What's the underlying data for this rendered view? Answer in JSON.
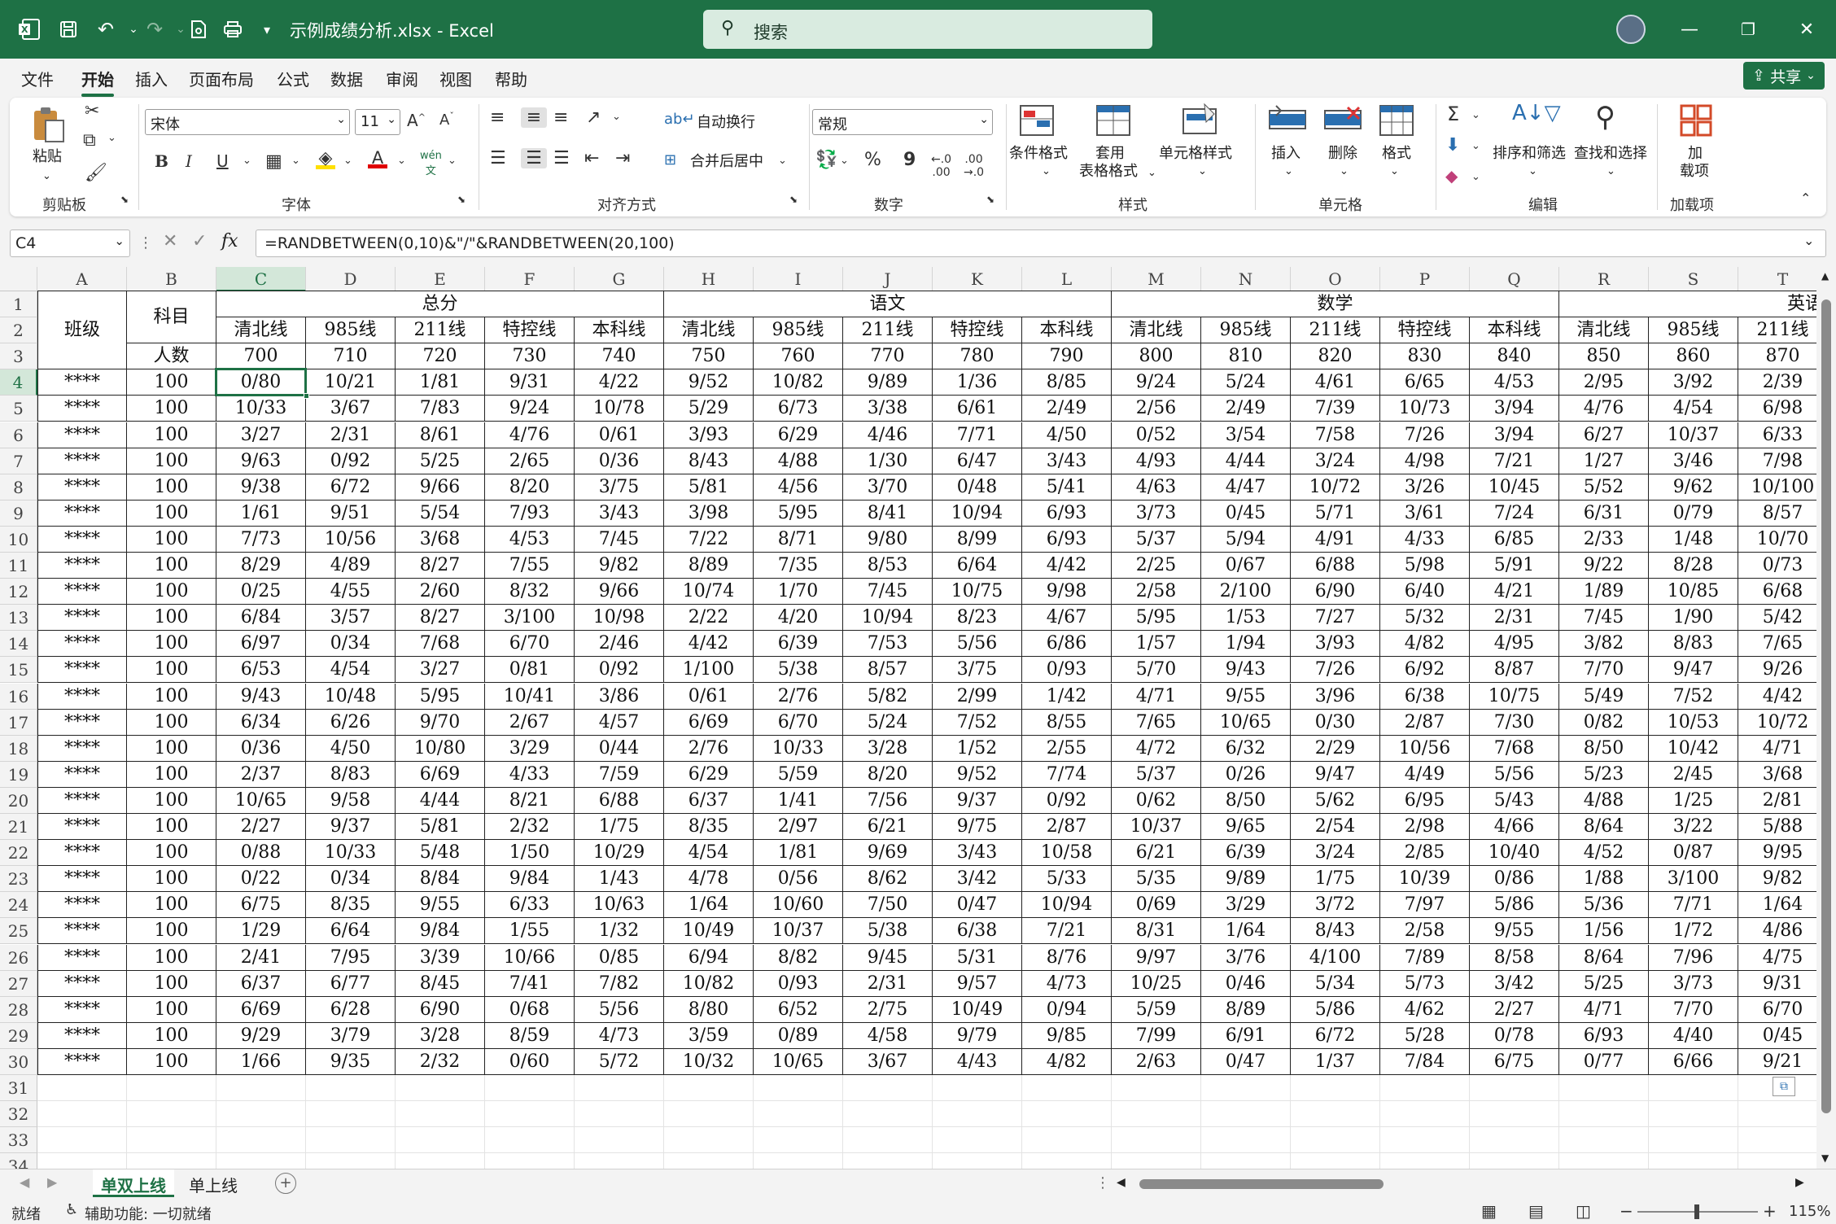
{
  "app": {
    "doc_title": "示例成绩分析.xlsx  -  Excel",
    "search_label": "搜索"
  },
  "menu": {
    "tabs": [
      "文件",
      "开始",
      "插入",
      "页面布局",
      "公式",
      "数据",
      "审阅",
      "视图",
      "帮助"
    ],
    "active": "开始",
    "share_label": "共享"
  },
  "ribbon": {
    "clipboard": {
      "paste": "粘贴",
      "label": "剪贴板"
    },
    "font": {
      "name": "宋体",
      "size": "11",
      "label": "字体",
      "bold": "B",
      "italic": "I",
      "underline": "U"
    },
    "alignment": {
      "wrap": "自动换行",
      "merge": "合并后居中",
      "label": "对齐方式"
    },
    "number": {
      "format": "常规",
      "percent": "%",
      "comma": "9",
      "label": "数字"
    },
    "styles": {
      "conditional": "条件格式",
      "table1": "套用",
      "table2": "表格格式",
      "cell_styles": "单元格样式",
      "label": "样式"
    },
    "cells": {
      "insert": "插入",
      "delete": "删除",
      "format": "格式",
      "label": "单元格"
    },
    "editing": {
      "sort": "排序和筛选",
      "find": "查找和选择",
      "label": "编辑"
    },
    "addins": {
      "line1": "加",
      "line2": "载项",
      "label": "加载项"
    }
  },
  "formula_bar": {
    "name_box": "C4",
    "fx": "fx",
    "formula": "=RANDBETWEEN(0,10)&\"/\"&RANDBETWEEN(20,100)"
  },
  "sheet": {
    "columns": [
      "A",
      "B",
      "C",
      "D",
      "E",
      "F",
      "G",
      "H",
      "I",
      "J",
      "K",
      "L",
      "M",
      "N",
      "O",
      "P",
      "Q",
      "R",
      "S",
      "T"
    ],
    "row_numbers": [
      "1",
      "2",
      "3",
      "4",
      "5",
      "6",
      "7",
      "8",
      "9",
      "10",
      "11",
      "12",
      "13",
      "14",
      "15",
      "16",
      "17",
      "18",
      "19",
      "20",
      "21",
      "22",
      "23",
      "24",
      "25",
      "26",
      "27",
      "28",
      "29",
      "30",
      "31",
      "32",
      "33",
      "34"
    ],
    "header": {
      "class_label": "班级",
      "subject_label": "科目",
      "count_label": "人数",
      "groups": [
        "总分",
        "语文",
        "数学",
        "英语"
      ],
      "lines": [
        "清北线",
        "985线",
        "211线",
        "特控线",
        "本科线",
        "清北线",
        "985线",
        "211线",
        "特控线",
        "本科线",
        "清北线",
        "985线",
        "211线",
        "特控线",
        "本科线",
        "清北线",
        "985线",
        "211线"
      ],
      "thresholds": [
        "700",
        "710",
        "720",
        "730",
        "740",
        "750",
        "760",
        "770",
        "780",
        "790",
        "800",
        "810",
        "820",
        "830",
        "840",
        "850",
        "860",
        "870"
      ]
    },
    "rows": [
      [
        "****",
        "100",
        "0/80",
        "10/21",
        "1/81",
        "9/31",
        "4/22",
        "9/52",
        "10/82",
        "9/89",
        "1/36",
        "8/85",
        "9/24",
        "5/24",
        "4/61",
        "6/65",
        "4/53",
        "2/95",
        "3/92",
        "2/39"
      ],
      [
        "****",
        "100",
        "10/33",
        "3/67",
        "7/83",
        "9/24",
        "10/78",
        "5/29",
        "6/73",
        "3/38",
        "6/61",
        "2/49",
        "2/56",
        "2/49",
        "7/39",
        "10/73",
        "3/94",
        "4/76",
        "4/54",
        "6/98"
      ],
      [
        "****",
        "100",
        "3/27",
        "2/31",
        "8/61",
        "4/76",
        "0/61",
        "3/93",
        "6/29",
        "4/46",
        "7/71",
        "4/50",
        "0/52",
        "3/54",
        "7/58",
        "7/26",
        "3/94",
        "6/27",
        "10/37",
        "6/33"
      ],
      [
        "****",
        "100",
        "9/63",
        "0/92",
        "5/25",
        "2/65",
        "0/36",
        "8/43",
        "4/88",
        "1/30",
        "6/47",
        "3/43",
        "4/93",
        "4/44",
        "3/24",
        "4/98",
        "7/21",
        "1/27",
        "3/46",
        "7/98"
      ],
      [
        "****",
        "100",
        "9/38",
        "6/72",
        "9/66",
        "8/20",
        "3/75",
        "5/81",
        "4/56",
        "3/70",
        "0/48",
        "5/41",
        "4/63",
        "4/47",
        "10/72",
        "3/26",
        "10/45",
        "5/52",
        "9/62",
        "10/100"
      ],
      [
        "****",
        "100",
        "1/61",
        "9/51",
        "5/54",
        "7/93",
        "3/43",
        "3/98",
        "5/95",
        "8/41",
        "10/94",
        "6/93",
        "3/73",
        "0/45",
        "5/71",
        "3/61",
        "7/24",
        "6/31",
        "0/79",
        "8/57"
      ],
      [
        "****",
        "100",
        "7/73",
        "10/56",
        "3/68",
        "4/53",
        "7/45",
        "7/22",
        "8/71",
        "9/80",
        "8/99",
        "6/93",
        "5/37",
        "5/94",
        "4/91",
        "4/33",
        "6/85",
        "2/33",
        "1/48",
        "10/70"
      ],
      [
        "****",
        "100",
        "8/29",
        "4/89",
        "8/27",
        "7/55",
        "9/82",
        "8/89",
        "7/35",
        "8/53",
        "6/64",
        "4/42",
        "2/25",
        "0/67",
        "6/88",
        "5/98",
        "5/91",
        "9/22",
        "8/28",
        "0/73"
      ],
      [
        "****",
        "100",
        "0/25",
        "4/55",
        "2/60",
        "8/32",
        "9/66",
        "10/74",
        "1/70",
        "7/45",
        "10/75",
        "9/98",
        "2/58",
        "2/100",
        "6/90",
        "6/40",
        "4/21",
        "1/89",
        "10/85",
        "6/68"
      ],
      [
        "****",
        "100",
        "6/84",
        "3/57",
        "8/27",
        "3/100",
        "10/98",
        "2/22",
        "4/20",
        "10/94",
        "8/23",
        "4/67",
        "5/95",
        "1/53",
        "7/27",
        "5/32",
        "2/31",
        "7/45",
        "1/90",
        "5/42"
      ],
      [
        "****",
        "100",
        "6/97",
        "0/34",
        "7/68",
        "6/70",
        "2/46",
        "4/42",
        "6/39",
        "7/53",
        "5/56",
        "6/86",
        "1/57",
        "1/94",
        "3/93",
        "4/82",
        "4/95",
        "3/82",
        "8/83",
        "7/65"
      ],
      [
        "****",
        "100",
        "6/53",
        "4/54",
        "3/27",
        "0/81",
        "0/92",
        "1/100",
        "5/38",
        "8/57",
        "3/75",
        "0/93",
        "5/70",
        "9/43",
        "7/26",
        "6/92",
        "8/87",
        "7/70",
        "9/47",
        "9/26"
      ],
      [
        "****",
        "100",
        "9/43",
        "10/48",
        "5/95",
        "10/41",
        "3/86",
        "0/61",
        "2/76",
        "5/82",
        "2/99",
        "1/42",
        "4/71",
        "9/55",
        "3/96",
        "6/38",
        "10/75",
        "5/49",
        "7/52",
        "4/42"
      ],
      [
        "****",
        "100",
        "6/34",
        "6/26",
        "9/70",
        "2/67",
        "4/57",
        "6/69",
        "6/70",
        "5/24",
        "7/52",
        "8/55",
        "7/65",
        "10/65",
        "0/30",
        "2/87",
        "7/30",
        "0/82",
        "10/53",
        "10/72"
      ],
      [
        "****",
        "100",
        "0/36",
        "4/50",
        "10/80",
        "3/29",
        "0/44",
        "2/76",
        "10/33",
        "3/28",
        "1/52",
        "2/55",
        "4/72",
        "6/32",
        "2/29",
        "10/56",
        "7/68",
        "8/50",
        "10/42",
        "4/71"
      ],
      [
        "****",
        "100",
        "2/37",
        "8/83",
        "6/69",
        "4/33",
        "7/59",
        "6/29",
        "5/59",
        "8/20",
        "9/52",
        "7/74",
        "5/37",
        "0/26",
        "9/47",
        "4/49",
        "5/56",
        "5/23",
        "2/45",
        "3/68"
      ],
      [
        "****",
        "100",
        "10/65",
        "9/58",
        "4/44",
        "8/21",
        "6/88",
        "6/37",
        "1/41",
        "7/56",
        "9/37",
        "0/92",
        "0/62",
        "8/50",
        "5/62",
        "6/95",
        "5/43",
        "4/88",
        "1/25",
        "2/81"
      ],
      [
        "****",
        "100",
        "2/27",
        "9/37",
        "5/81",
        "2/32",
        "1/75",
        "8/35",
        "2/97",
        "6/21",
        "9/75",
        "2/87",
        "10/37",
        "9/65",
        "2/54",
        "2/98",
        "4/66",
        "8/64",
        "3/22",
        "5/88"
      ],
      [
        "****",
        "100",
        "0/88",
        "10/33",
        "5/48",
        "1/50",
        "10/29",
        "4/54",
        "1/81",
        "9/69",
        "3/43",
        "10/58",
        "6/21",
        "6/39",
        "3/24",
        "2/85",
        "10/40",
        "4/52",
        "0/87",
        "9/95"
      ],
      [
        "****",
        "100",
        "0/22",
        "0/34",
        "8/84",
        "9/84",
        "1/43",
        "4/78",
        "0/56",
        "8/62",
        "3/42",
        "5/33",
        "5/35",
        "9/89",
        "1/75",
        "10/39",
        "0/86",
        "1/88",
        "3/100",
        "9/82"
      ],
      [
        "****",
        "100",
        "6/75",
        "8/35",
        "9/55",
        "6/33",
        "10/63",
        "1/64",
        "10/60",
        "7/50",
        "0/47",
        "10/94",
        "0/69",
        "3/29",
        "3/72",
        "7/97",
        "5/86",
        "5/36",
        "7/71",
        "1/64"
      ],
      [
        "****",
        "100",
        "1/29",
        "6/64",
        "9/84",
        "1/55",
        "1/32",
        "10/49",
        "10/37",
        "5/38",
        "6/38",
        "7/21",
        "8/31",
        "1/64",
        "8/43",
        "2/58",
        "9/55",
        "1/56",
        "1/72",
        "4/86"
      ],
      [
        "****",
        "100",
        "2/41",
        "7/95",
        "3/39",
        "10/66",
        "0/85",
        "6/94",
        "8/82",
        "9/45",
        "5/31",
        "8/76",
        "9/97",
        "3/76",
        "4/100",
        "7/89",
        "8/58",
        "8/64",
        "7/96",
        "4/75"
      ],
      [
        "****",
        "100",
        "6/37",
        "6/77",
        "8/45",
        "7/41",
        "7/82",
        "10/82",
        "0/93",
        "2/31",
        "9/57",
        "4/73",
        "10/25",
        "0/46",
        "5/34",
        "5/73",
        "3/42",
        "5/25",
        "3/73",
        "9/31"
      ],
      [
        "****",
        "100",
        "6/69",
        "6/28",
        "6/90",
        "0/68",
        "5/56",
        "8/80",
        "6/52",
        "2/75",
        "10/49",
        "0/94",
        "5/59",
        "8/89",
        "5/86",
        "4/62",
        "2/27",
        "4/71",
        "7/70",
        "6/70"
      ],
      [
        "****",
        "100",
        "9/29",
        "3/79",
        "3/28",
        "8/59",
        "4/73",
        "3/59",
        "0/89",
        "4/58",
        "9/79",
        "9/85",
        "7/99",
        "6/91",
        "6/72",
        "5/28",
        "0/78",
        "6/93",
        "4/40",
        "0/45"
      ],
      [
        "****",
        "100",
        "1/66",
        "9/35",
        "2/32",
        "0/60",
        "5/72",
        "10/32",
        "10/65",
        "3/67",
        "4/43",
        "4/82",
        "2/63",
        "0/47",
        "1/37",
        "7/84",
        "6/75",
        "0/77",
        "6/66",
        "9/21"
      ]
    ]
  },
  "sheet_tabs": [
    "单双上线",
    "单上线"
  ],
  "status": {
    "ready": "就绪",
    "accessibility": "辅助功能: 一切就绪",
    "zoom": "115%"
  },
  "colors": {
    "accent": "#1e7145",
    "selection_fill": "#d3e7d9"
  }
}
